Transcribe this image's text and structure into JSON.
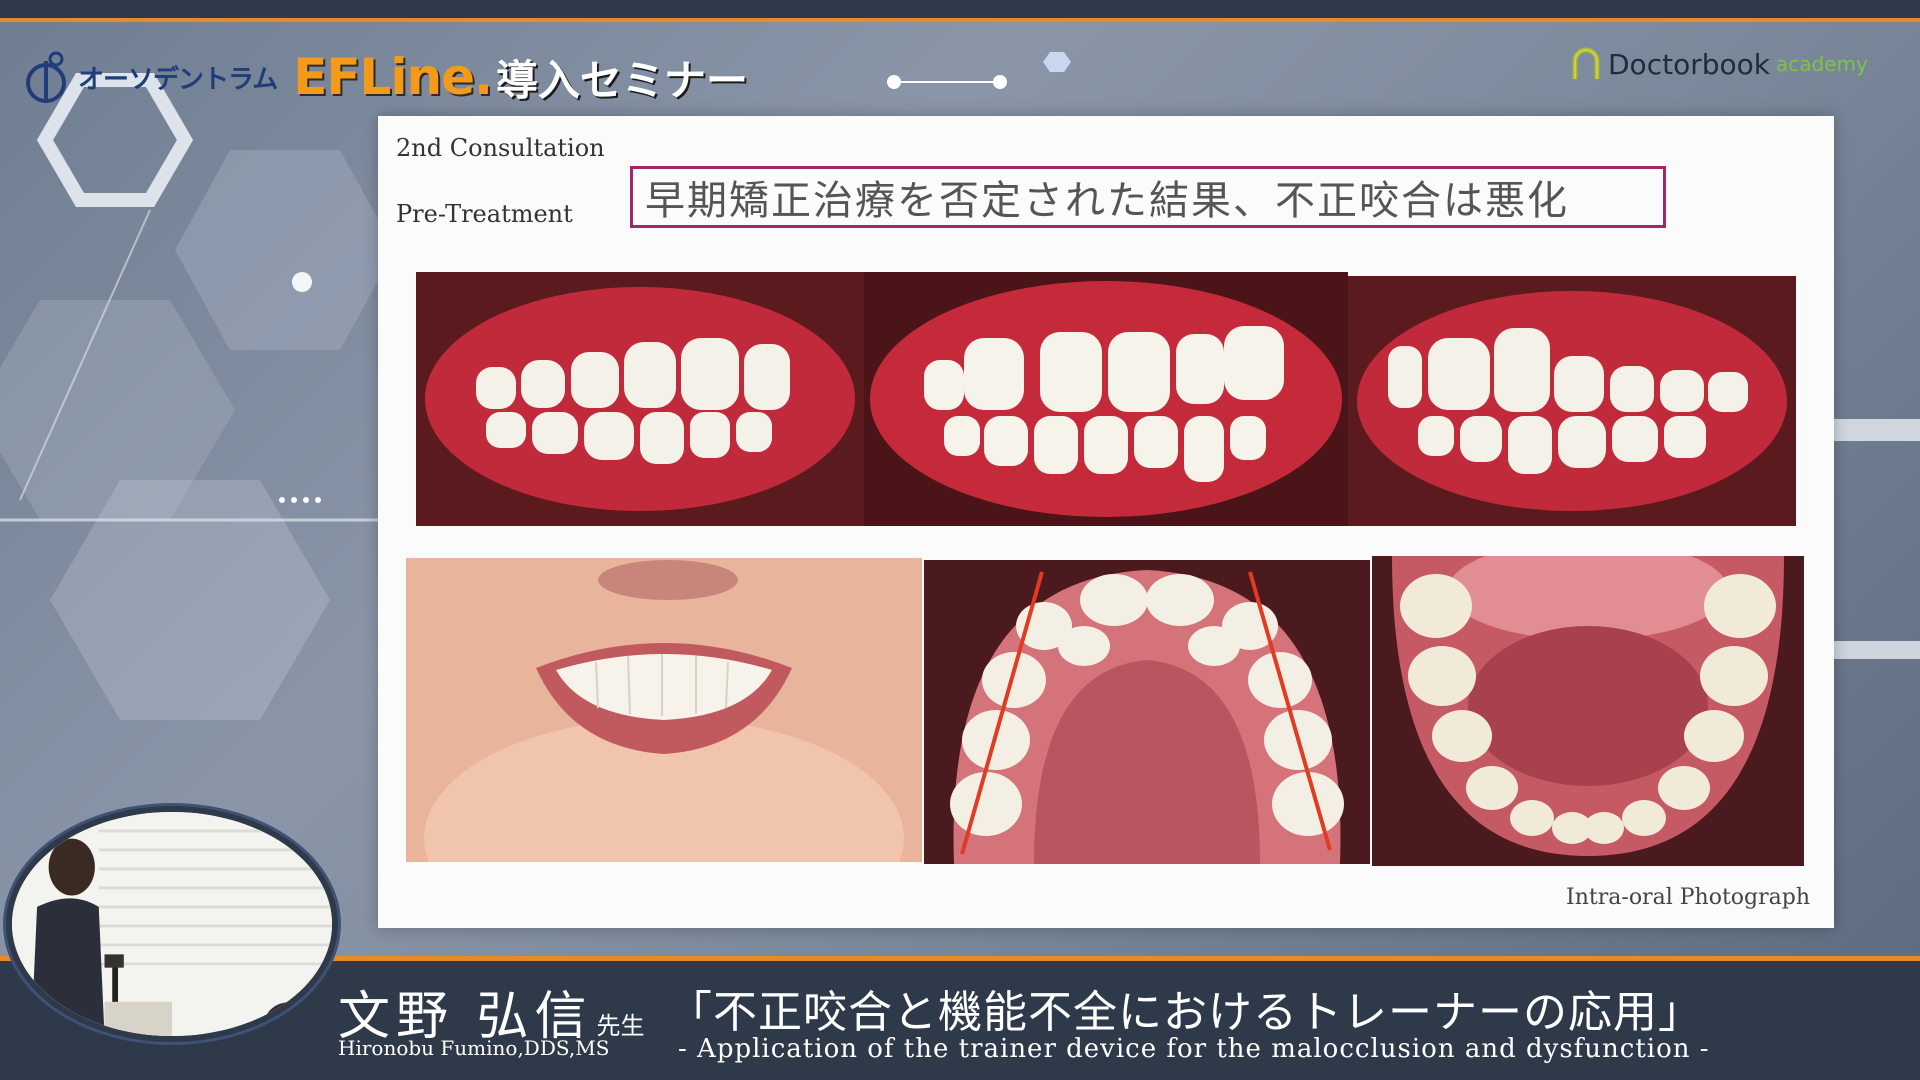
{
  "header": {
    "org_logo_text": "オーソデントラム",
    "event_brand": "EFLine.",
    "event_title": "導入セミナー",
    "partner_logo_text": "Doctorbook",
    "partner_logo_sub": "academy"
  },
  "slide": {
    "label_consultation": "2nd Consultation",
    "label_phase": "Pre-Treatment",
    "title": "早期矯正治療を否定された結果、不正咬合は悪化",
    "caption": "Intra-oral Photograph",
    "photos": [
      {
        "name": "right-lateral-view"
      },
      {
        "name": "frontal-view"
      },
      {
        "name": "left-lateral-view"
      },
      {
        "name": "smile-face-view"
      },
      {
        "name": "upper-occlusal-view"
      },
      {
        "name": "lower-occlusal-view"
      }
    ]
  },
  "lower_third": {
    "presenter_name": "文野 弘信",
    "presenter_suffix": "先生",
    "presenter_en": "Hironobu Fumino,DDS,MS",
    "talk_title": "「不正咬合と機能不全におけるトレーナーの応用」",
    "talk_subtitle": "- Application of the trainer device for the malocclusion and dysfunction -"
  },
  "colors": {
    "accent_orange": "#e8892b",
    "band_navy": "#2e3a4a",
    "title_border": "#a4266d"
  }
}
